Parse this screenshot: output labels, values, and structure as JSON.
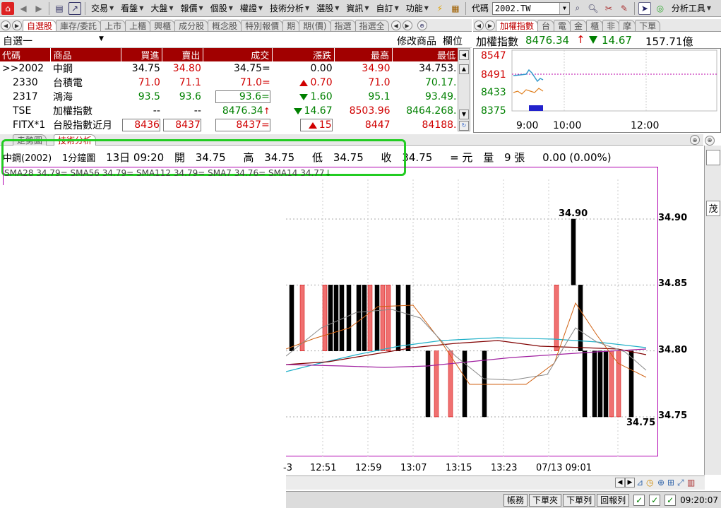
{
  "menu": {
    "items": [
      "交易",
      "看盤",
      "大盤",
      "報價",
      "個股",
      "權證",
      "技術分析",
      "選股",
      "資訊",
      "自訂",
      "功能"
    ],
    "code_label": "代碼",
    "code_value": "2002.TW",
    "analysis_tools": "分析工具"
  },
  "quote_panel": {
    "tabs": [
      "自選股",
      "庫存/委託",
      "上市",
      "上櫃",
      "興櫃",
      "成分股",
      "概念股",
      "特別報價",
      "期",
      "期(價)",
      "指選",
      "指選全"
    ],
    "watchlist_name": "自選一",
    "modify_label": "修改商品",
    "column_label": "欄位",
    "headers": [
      "代碼",
      "商品",
      "買進",
      "賣出",
      "成交",
      "漲跌",
      "最高",
      "最低"
    ],
    "rows": [
      {
        "code": ">>2002",
        "name": "中鋼",
        "bid": "34.75",
        "ask": "34.80",
        "last": "34.75=",
        "change": "0.00",
        "high": "34.90",
        "low": "34.753."
      },
      {
        "code": "2330",
        "name": "台積電",
        "bid": "71.0",
        "ask": "71.1",
        "last": "71.0=",
        "change": "0.70",
        "high": "71.0",
        "low": "70.17."
      },
      {
        "code": "2317",
        "name": "鴻海",
        "bid": "93.5",
        "ask": "93.6",
        "last": "93.6=",
        "change": "1.60",
        "high": "95.1",
        "low": "93.49."
      },
      {
        "code": "TSE",
        "name": "加權指數",
        "bid": "--",
        "ask": "--",
        "last": "8476.34",
        "change": "14.67",
        "high": "8503.96",
        "low": "8464.268."
      },
      {
        "code": "FITX*1",
        "name": "台股指數近月",
        "bid": "8436",
        "ask": "8437",
        "last": "8437=",
        "change": "15",
        "high": "8447",
        "low": "84188."
      }
    ]
  },
  "index_panel": {
    "tabs": [
      "加權指數",
      "台",
      "電",
      "金",
      "櫃",
      "非",
      "摩",
      "下單"
    ],
    "title": "加權指數",
    "value": "8476.34",
    "change": "14.67",
    "volume": "157.71億",
    "y_labels": [
      "8547",
      "8491",
      "8433",
      "8375"
    ],
    "x_labels": [
      "9:00",
      "10:00",
      "12:00"
    ]
  },
  "chart_panel": {
    "tabs": [
      "走勢圖",
      "技術分析"
    ],
    "info": {
      "stock": "中鋼(2002)",
      "period": "1分鐘圖",
      "datetime": "13日 09:20",
      "open_label": "開",
      "open": "34.75",
      "high_label": "高",
      "high": "34.75",
      "low_label": "低",
      "low": "34.75",
      "close_label": "收",
      "close": "34.75",
      "unit": "= 元",
      "vol_label": "量",
      "vol": "9 張",
      "chg": "0.00 (0.00%)"
    },
    "ma_line": "SMA28 34.79=  SMA56 34.79=  SMA112 34.79=  SMA7 34.76=  SMA14 34.77",
    "right_tab": "茂"
  },
  "chart_data": {
    "type": "bar",
    "y_ticks": [
      "34.90",
      "34.85",
      "34.80",
      "34.75"
    ],
    "x_ticks": [
      "-3",
      "12:51",
      "12:59",
      "13:07",
      "13:15",
      "13:23",
      "07/13 09:01"
    ],
    "ylim": [
      34.72,
      34.93
    ],
    "annotations": [
      "34.90",
      "34.75"
    ]
  },
  "status_bar": {
    "buttons": [
      "帳務",
      "下單夾",
      "下單列",
      "回報列"
    ],
    "time": "09:20:07"
  },
  "colors": {
    "header_red": "#a10000",
    "highlight_green": "#22cc22",
    "chart_frame": "#b000b0"
  }
}
